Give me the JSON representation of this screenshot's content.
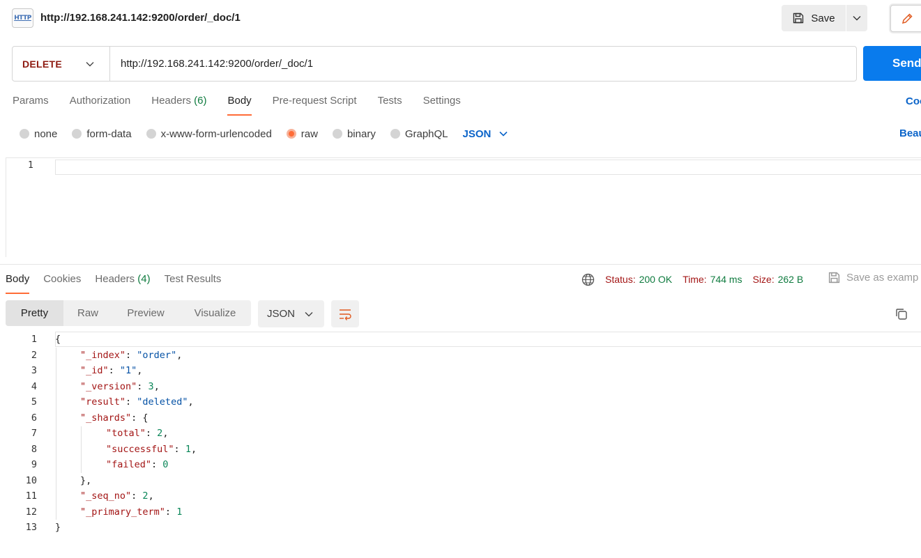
{
  "header": {
    "icon_text": "HTTP",
    "url_title": "http://192.168.241.142:9200/order/_doc/1",
    "save_label": "Save"
  },
  "request": {
    "method": "DELETE",
    "url": "http://192.168.241.142:9200/order/_doc/1",
    "send_label": "Send"
  },
  "request_tabs": [
    {
      "label": "Params",
      "count": ""
    },
    {
      "label": "Authorization",
      "count": ""
    },
    {
      "label": "Headers",
      "count": "(6)"
    },
    {
      "label": "Body",
      "count": "",
      "active": true
    },
    {
      "label": "Pre-request Script",
      "count": ""
    },
    {
      "label": "Tests",
      "count": ""
    },
    {
      "label": "Settings",
      "count": ""
    }
  ],
  "code_link": "Coo",
  "body_types": {
    "options": [
      "none",
      "form-data",
      "x-www-form-urlencoded",
      "raw",
      "binary",
      "GraphQL"
    ],
    "selected": "raw",
    "format": "JSON",
    "beautify": "Beau"
  },
  "request_editor": {
    "line_numbers": [
      "1"
    ]
  },
  "response_tabs": [
    {
      "label": "Body",
      "count": ""
    },
    {
      "label": "Cookies",
      "count": ""
    },
    {
      "label": "Headers",
      "count": "(4)"
    },
    {
      "label": "Test Results",
      "count": ""
    }
  ],
  "response_status": {
    "status_label": "Status:",
    "status_value": "200 OK",
    "time_label": "Time:",
    "time_value": "744 ms",
    "size_label": "Size:",
    "size_value": "262 B",
    "save_example": "Save as examp"
  },
  "response_view": {
    "modes": [
      "Pretty",
      "Raw",
      "Preview",
      "Visualize"
    ],
    "active_mode": "Pretty",
    "language": "JSON"
  },
  "response_body": {
    "line_numbers": [
      "1",
      "2",
      "3",
      "4",
      "5",
      "6",
      "7",
      "8",
      "9",
      "10",
      "11",
      "12",
      "13"
    ],
    "lines": [
      "{",
      "\"_index\": \"order\",",
      "\"_id\": \"1\",",
      "\"_version\": 3,",
      "\"result\": \"deleted\",",
      "\"_shards\": {",
      "\"total\": 2,",
      "\"successful\": 1,",
      "\"failed\": 0",
      "},",
      "\"_seq_no\": 2,",
      "\"_primary_term\": 1",
      "}"
    ]
  },
  "colors": {
    "accent": "#ff6c37",
    "send": "#097bed",
    "method": "#8e1a10",
    "status_ok": "#0f7b3f",
    "link": "#0b64c9"
  }
}
